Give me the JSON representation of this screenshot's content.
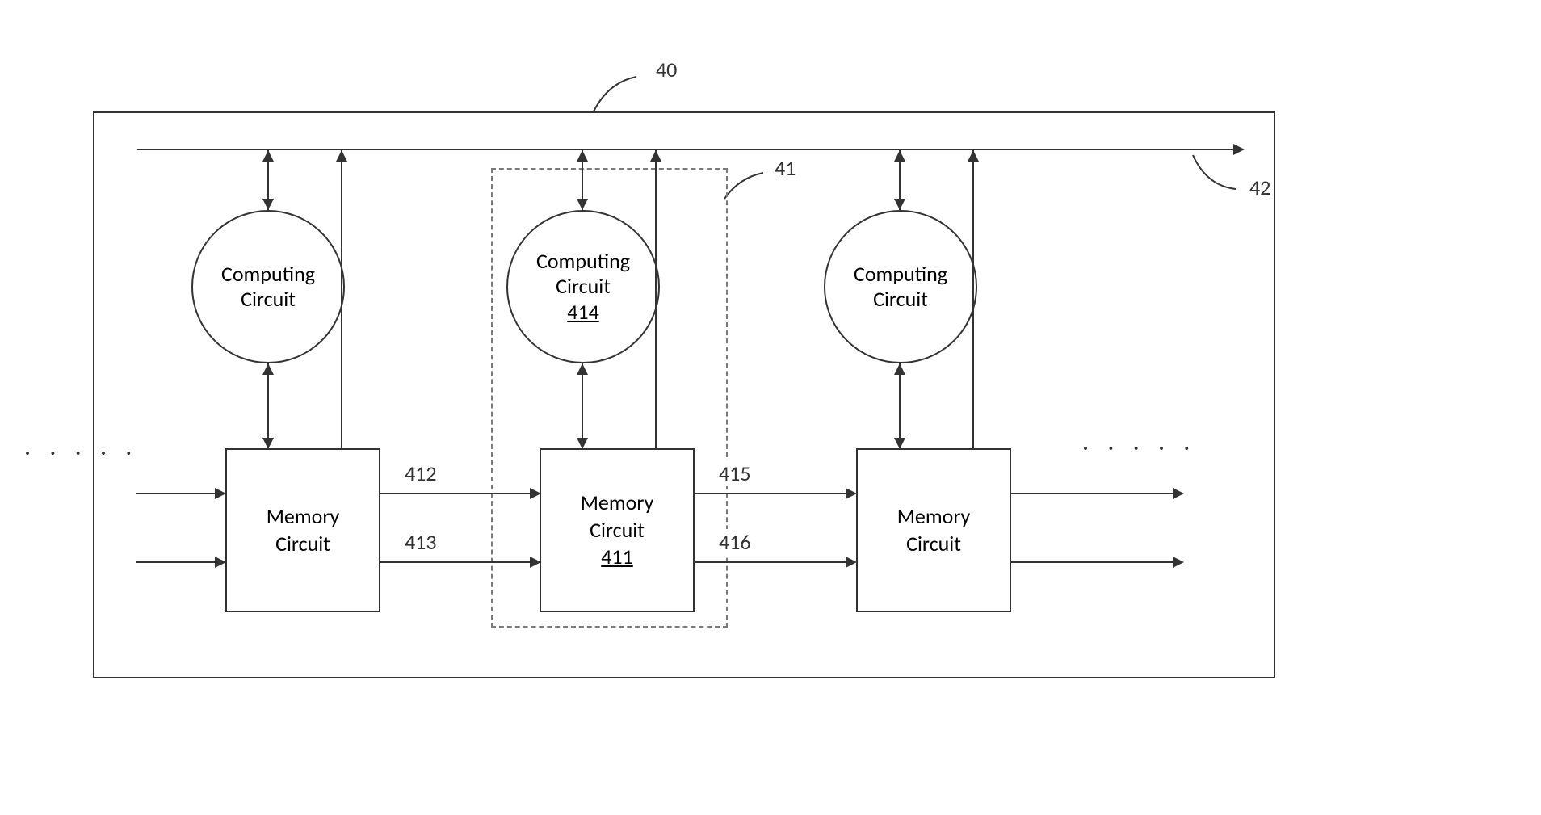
{
  "labels": {
    "ref40": "40",
    "ref41": "41",
    "ref42": "42",
    "ref411": "411",
    "ref412": "412",
    "ref413": "413",
    "ref414": "414",
    "ref415": "415",
    "ref416": "416"
  },
  "text": {
    "computing": "Computing",
    "circuit": "Circuit",
    "memory": "Memory"
  }
}
